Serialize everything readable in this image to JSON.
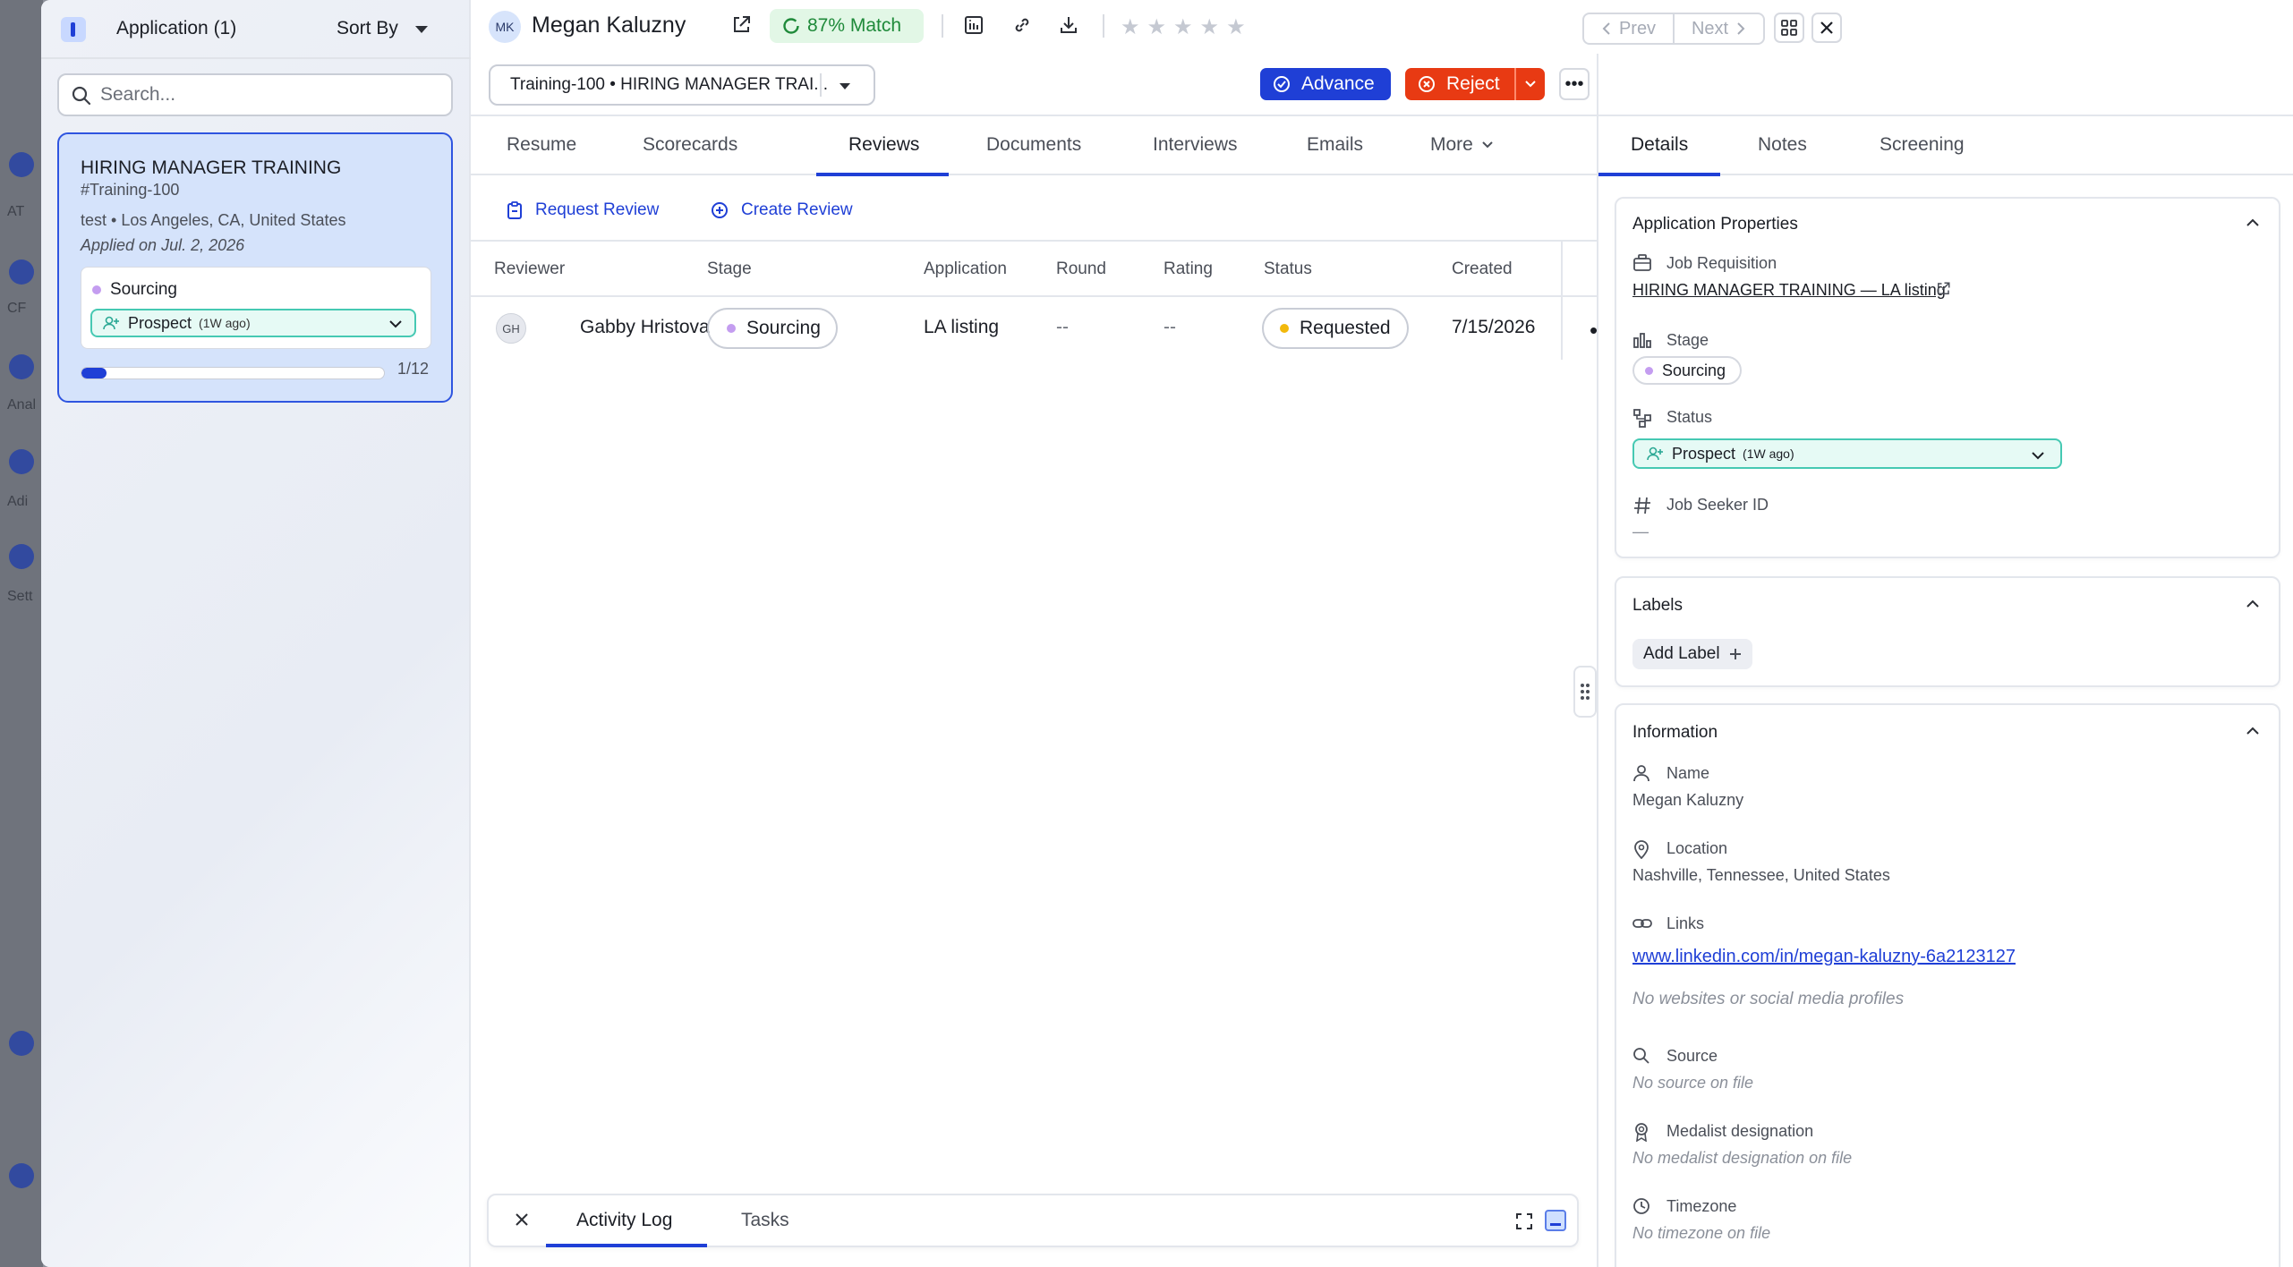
{
  "background": {
    "labels": [
      "AT",
      "CF",
      "Anal",
      "Adi",
      "Sett"
    ]
  },
  "left_panel": {
    "title": "Application (1)",
    "sort_label": "Sort By",
    "search_placeholder": "Search...",
    "card": {
      "title": "HIRING MANAGER TRAINING",
      "req_id": "#Training-100",
      "location": "test • Los Angeles, CA, United States",
      "applied": "Applied on Jul. 2, 2026",
      "stage": "Sourcing",
      "status": "Prospect",
      "status_age": "(1W ago)",
      "progress_text": "1/12",
      "progress_fraction": 0.083
    }
  },
  "header": {
    "initials": "MK",
    "name": "Megan Kaluzny",
    "match": "87% Match",
    "rating_stars": 5,
    "rating_value": 0,
    "prev": "Prev",
    "next": "Next",
    "requisition_select": "Training-100 • HIRING MANAGER TRAI...",
    "advance": "Advance",
    "reject": "Reject"
  },
  "center_tabs": [
    "Resume",
    "Scorecards",
    "Reviews",
    "Documents",
    "Interviews",
    "Emails",
    "More"
  ],
  "active_center_tab": "Reviews",
  "actions": {
    "request_review": "Request Review",
    "create_review": "Create Review"
  },
  "table": {
    "columns": [
      "Reviewer",
      "Stage",
      "Application",
      "Round",
      "Rating",
      "Status",
      "Created"
    ],
    "rows": [
      {
        "initials": "GH",
        "reviewer": "Gabby Hristova",
        "stage": "Sourcing",
        "application": "LA listing",
        "round": "--",
        "rating": "--",
        "status": "Requested",
        "created": "7/15/2026"
      }
    ]
  },
  "activity_bar": {
    "tabs": [
      "Activity Log",
      "Tasks"
    ]
  },
  "right_panel": {
    "tabs": [
      "Details",
      "Notes",
      "Screening"
    ],
    "application_properties": {
      "title": "Application Properties",
      "job_requisition_label": "Job Requisition",
      "job_requisition_value": "HIRING MANAGER TRAINING — LA listing",
      "stage_label": "Stage",
      "stage_value": "Sourcing",
      "status_label": "Status",
      "status_value": "Prospect",
      "status_age": "(1W ago)",
      "job_seeker_id_label": "Job Seeker ID",
      "job_seeker_id_value": "—"
    },
    "labels": {
      "title": "Labels",
      "add_label": "Add Label"
    },
    "information": {
      "title": "Information",
      "name_label": "Name",
      "name_value": "Megan Kaluzny",
      "location_label": "Location",
      "location_value": "Nashville, Tennessee, United States",
      "links_label": "Links",
      "links_value": "www.linkedin.com/in/megan-kaluzny-6a2123127",
      "links_empty": "No websites or social media profiles",
      "source_label": "Source",
      "source_empty": "No source on file",
      "medalist_label": "Medalist designation",
      "medalist_empty": "No medalist designation on file",
      "timezone_label": "Timezone",
      "timezone_empty": "No timezone on file"
    }
  },
  "colors": {
    "accent": "#1f3fd6",
    "reject": "#e83a13",
    "match_green": "#1f8a3a",
    "sourcing_dot": "#c49df0",
    "requested_dot": "#f2b90c",
    "prospect_border": "#46c9b3"
  }
}
